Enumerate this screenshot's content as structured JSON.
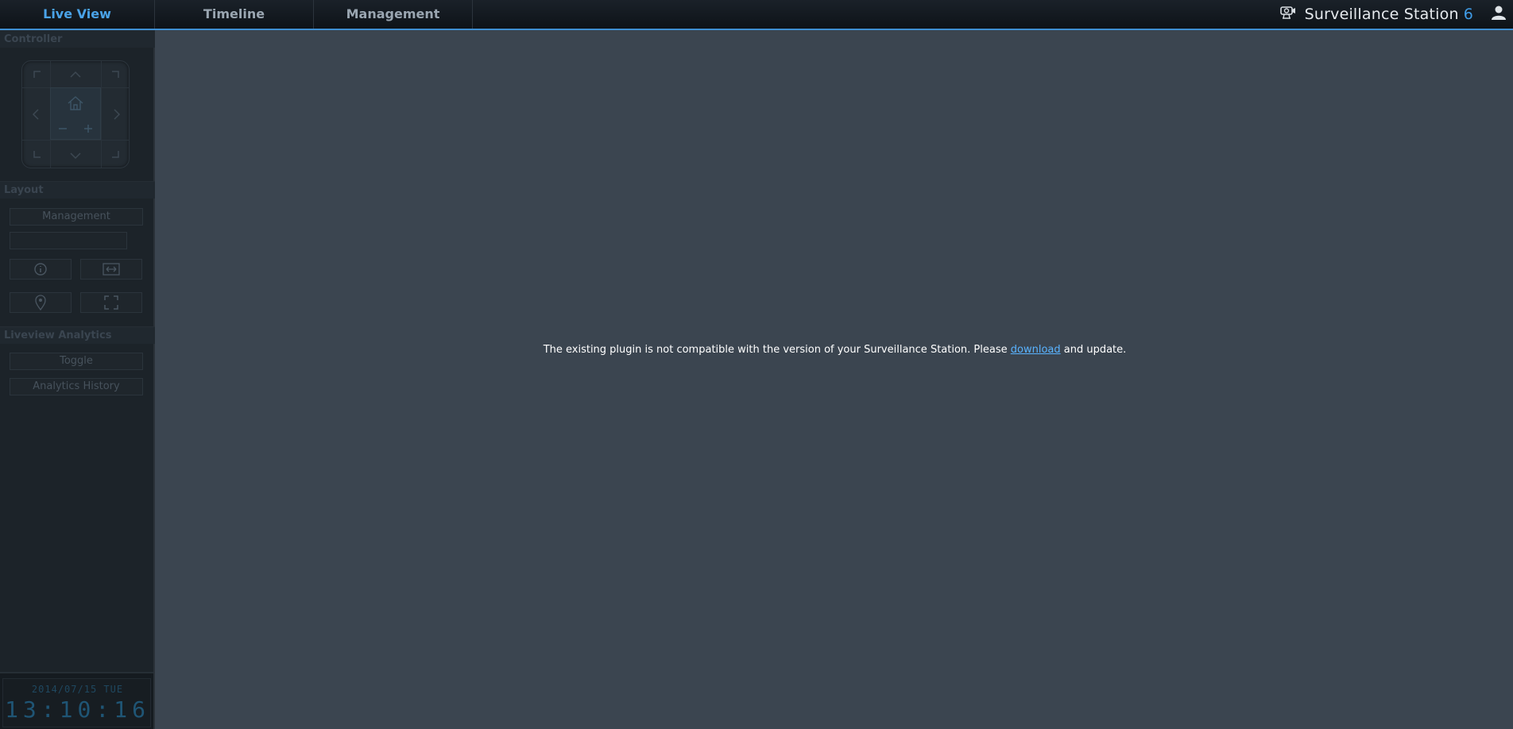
{
  "nav": {
    "tabs": [
      {
        "label": "Live View",
        "active": true
      },
      {
        "label": "Timeline",
        "active": false
      },
      {
        "label": "Management",
        "active": false
      }
    ],
    "brand": "Surveillance Station",
    "brand_version": "6",
    "user_icon": "user-icon"
  },
  "sidebar": {
    "controller": {
      "title": "Controller"
    },
    "layout": {
      "title": "Layout",
      "management_label": "Management",
      "icon_buttons": [
        "info-icon",
        "fit-width-icon",
        "location-pin-icon",
        "fullscreen-icon"
      ]
    },
    "analytics": {
      "title": "Liveview Analytics",
      "toggle_label": "Toggle",
      "history_label": "Analytics History"
    },
    "clock": {
      "date": "2014/07/15  TUE",
      "time": "13:10:16"
    }
  },
  "main": {
    "message_before": "The existing plugin is not compatible with the version of your Surveillance Station. Please ",
    "link_text": "download",
    "message_after": " and update."
  },
  "colors": {
    "accent": "#3f9be6",
    "main_bg": "#3b4550",
    "sidebar_bg": "#1c2329",
    "topbar_bg": "#12181e"
  }
}
